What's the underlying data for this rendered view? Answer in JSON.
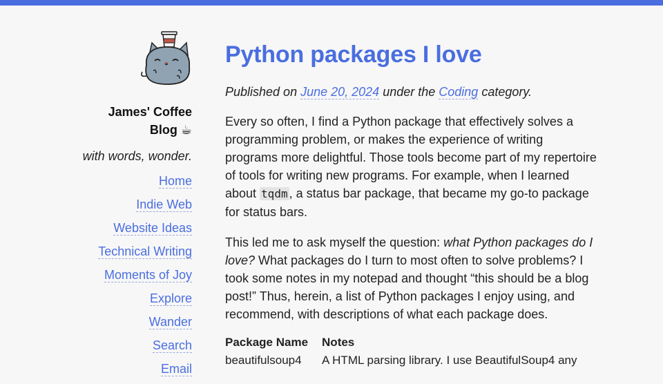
{
  "colors": {
    "accent": "#4a6ee0",
    "background": "#f7f7f7",
    "text": "#222222"
  },
  "sidebar": {
    "avatar_icon": "cat-with-coffee-cup-icon",
    "site_title_line1": "James' Coffee",
    "site_title_line2": "Blog ☕",
    "tagline": "with words, wonder.",
    "nav": [
      {
        "label": "Home"
      },
      {
        "label": "Indie Web"
      },
      {
        "label": "Website Ideas"
      },
      {
        "label": "Technical Writing"
      },
      {
        "label": "Moments of Joy"
      },
      {
        "label": "Explore"
      },
      {
        "label": "Wander"
      },
      {
        "label": "Search"
      },
      {
        "label": "Email"
      }
    ]
  },
  "post": {
    "title": "Python packages I love",
    "meta_prefix": "Published on ",
    "date": "June 20, 2024",
    "meta_middle": " under the ",
    "category": "Coding",
    "meta_suffix": " category.",
    "p1_before": "Every so often, I find a Python package that effectively solves a programming problem, or makes the experience of writing programs more delightful. Those tools become part of my repertoire of tools for writing new programs. For example, when I learned about ",
    "p1_code": "tqdm",
    "p1_after": ", a status bar package, that became my go-to package for status bars.",
    "p2_before": "This led me to ask myself the question: ",
    "p2_italic": "what Python packages do I love?",
    "p2_after": " What packages do I turn to most often to solve problems? I took some notes in my notepad and thought “this should be a blog post!” Thus, herein, a list of Python packages I enjoy using, and recommend, with descriptions of what each package does.",
    "table": {
      "headers": [
        "Package Name",
        "Notes"
      ],
      "rows": [
        [
          "beautifulsoup4",
          "A HTML parsing library. I use BeautifulSoup4 any"
        ]
      ]
    }
  }
}
